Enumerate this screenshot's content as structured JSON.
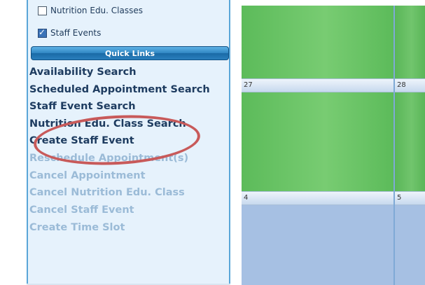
{
  "filters": {
    "nutrition_label": "Nutrition Edu. Classes",
    "staff_events_label": "Staff Events"
  },
  "quick_links": {
    "header": "Quick Links",
    "links": [
      {
        "label": "Availability Search",
        "enabled": true
      },
      {
        "label": "Scheduled Appointment Search",
        "enabled": true
      },
      {
        "label": "Staff Event Search",
        "enabled": true
      },
      {
        "label": "Nutrition Edu. Class Search",
        "enabled": true
      },
      {
        "label": "Create Staff Event",
        "enabled": true
      },
      {
        "label": "Reschedule Appointment(s)",
        "enabled": false
      },
      {
        "label": "Cancel Appointment",
        "enabled": false
      },
      {
        "label": "Cancel Nutrition Edu. Class",
        "enabled": false
      },
      {
        "label": "Cancel Staff Event",
        "enabled": false
      },
      {
        "label": "Create Time Slot",
        "enabled": false
      }
    ]
  },
  "calendar": {
    "day_labels": [
      "27",
      "28",
      "4",
      "5"
    ]
  },
  "colors": {
    "highlight": "#c85a5a",
    "event_green": "#6cc468",
    "empty_blue": "#a6c0e3"
  }
}
